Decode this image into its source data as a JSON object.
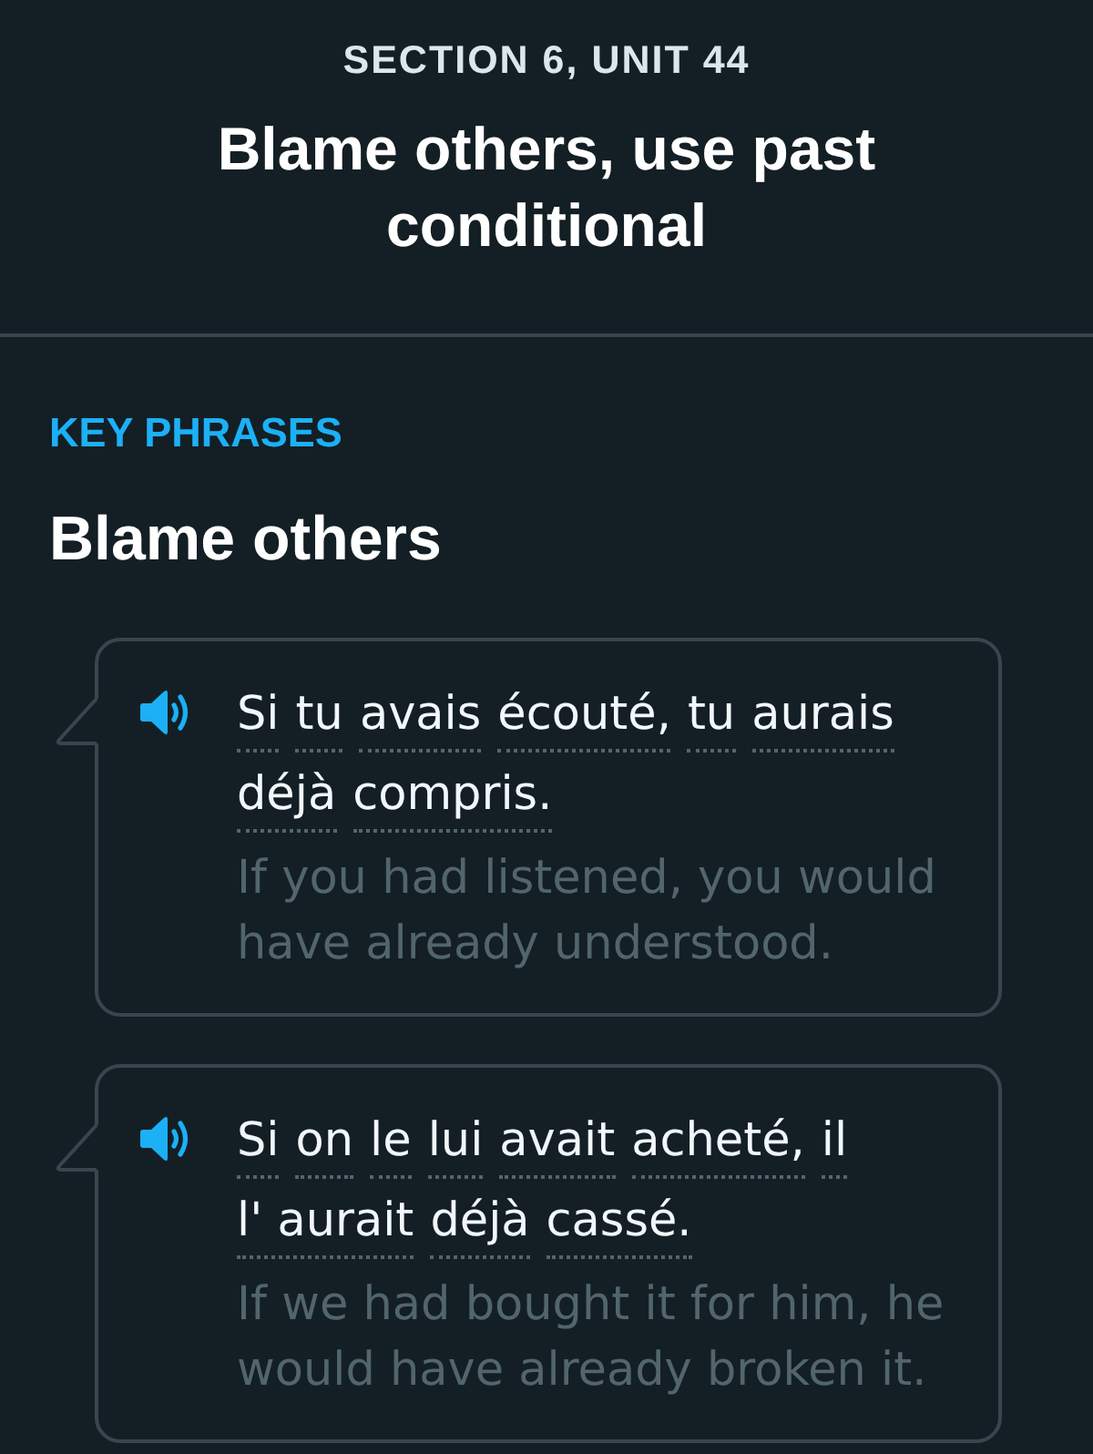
{
  "header": {
    "section": "SECTION 6, UNIT 44",
    "title": "Blame others, use past conditional"
  },
  "key_phrases": {
    "heading": "KEY PHRASES",
    "topic": "Blame others",
    "phrases": [
      {
        "lines": [
          [
            "Si",
            "tu",
            "avais",
            "écouté,",
            "tu",
            "aurais"
          ],
          [
            "déjà",
            "compris."
          ]
        ],
        "translation": "If you had listened, you would have already understood."
      },
      {
        "lines": [
          [
            "Si",
            "on",
            "le",
            "lui",
            "avait",
            "acheté,",
            "il"
          ],
          [
            "l' aurait",
            "déjà",
            "cassé."
          ]
        ],
        "translation": "If we had bought it for him, he would have already broken it."
      }
    ]
  }
}
